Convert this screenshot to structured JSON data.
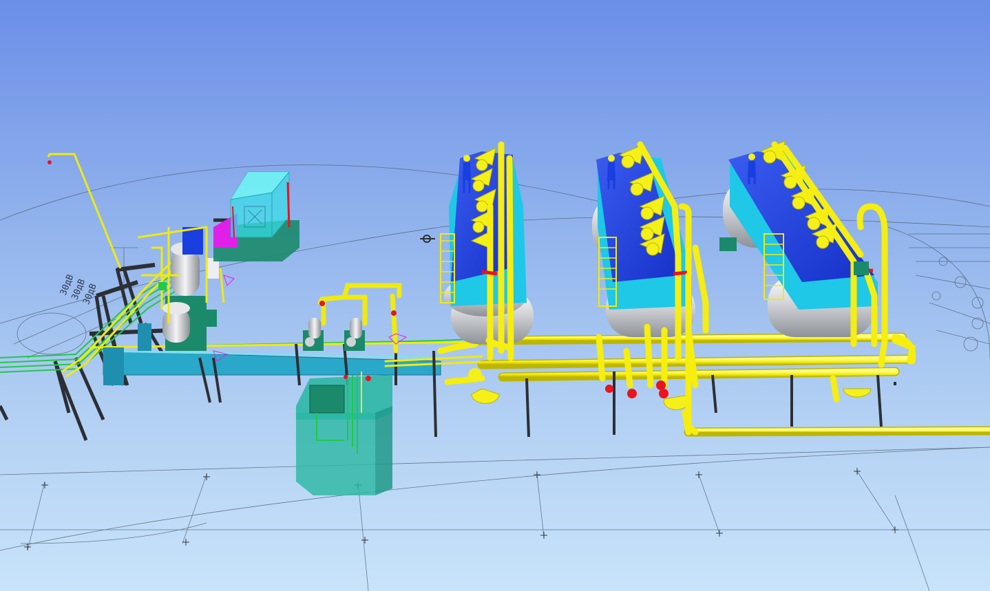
{
  "viewport": {
    "background_top": "#6b8ee8",
    "background_bottom": "#c8e3fa"
  },
  "colors": {
    "pipe": "#f5f01a",
    "pipe_shadow": "#c9c100",
    "vessel": "#d9d9dc",
    "tank_top": "#1a3fe0",
    "tank_side": "#1ec8e6",
    "steel": "#2c2f36",
    "duct": "#2aa8c9",
    "valve_red": "#e8141e",
    "enclosure": "#25b6a0",
    "skid_magenta": "#e020e8",
    "cabinet_cyan": "#36e0e8",
    "green_lines": "#22c84a"
  },
  "drawing_labels": [
    "30дВ",
    "30дВ",
    "30дВ"
  ],
  "objects": [
    {
      "name": "hydrocyclone-unit-1",
      "icon": "tank-icon"
    },
    {
      "name": "hydrocyclone-unit-2",
      "icon": "tank-icon"
    },
    {
      "name": "hydrocyclone-unit-3",
      "icon": "tank-icon"
    },
    {
      "name": "pump-module",
      "icon": "pump-icon"
    },
    {
      "name": "control-cabinet",
      "icon": "cabinet-icon"
    },
    {
      "name": "drain-enclosure",
      "icon": "enclosure-icon"
    }
  ]
}
